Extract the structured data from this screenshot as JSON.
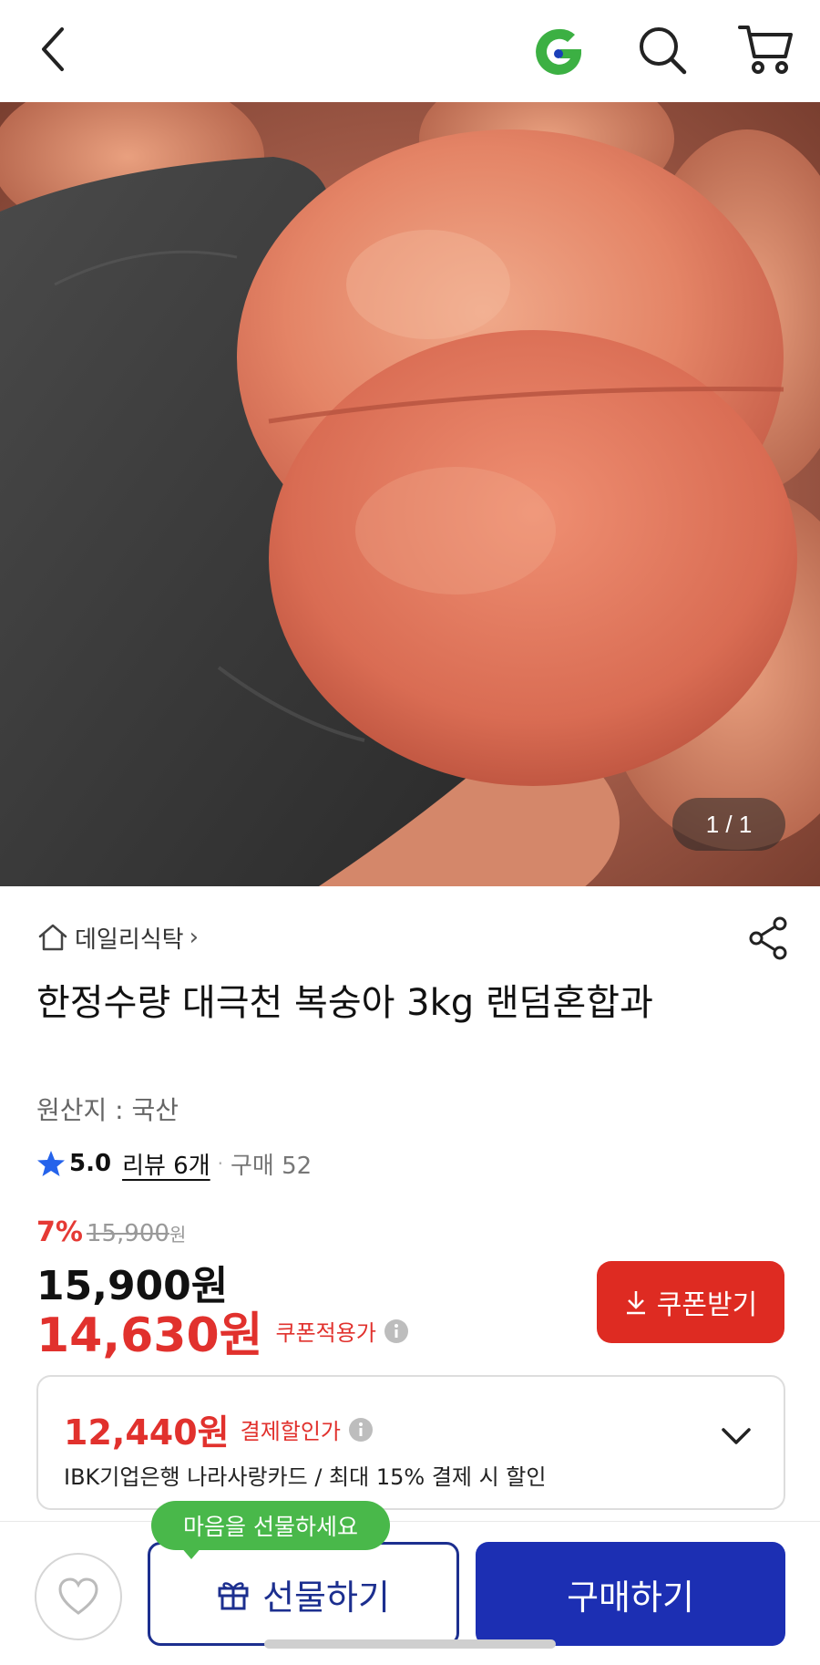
{
  "header": {
    "back_icon": "chevron-left-icon",
    "logo_icon": "gmarket-g-logo",
    "search_icon": "search-icon",
    "cart_icon": "cart-icon",
    "logo_color": "#3cb043"
  },
  "gallery": {
    "counter": "1 / 1"
  },
  "store": {
    "name": "데일리식탁",
    "chevron": "›"
  },
  "product": {
    "title": "한정수량 대극천 복숭아 3kg 랜덤혼합과",
    "origin": "원산지 : 국산",
    "rating": "5.0",
    "review_label": "리뷰 6개",
    "separator": "·",
    "purchase_label": "구매 52"
  },
  "pricing": {
    "discount_rate": "7%",
    "original_price": "15,900",
    "original_won": "원",
    "price": "15,900원",
    "coupon_price": "14,630원",
    "coupon_price_label": "쿠폰적용가",
    "coupon_button": "쿠폰받기",
    "accent_color": "#e1312d"
  },
  "card_discount": {
    "price": "12,440원",
    "label": "결제할인가",
    "description": "IBK기업은행 나라사랑카드 / 최대 15% 결제 시 할인"
  },
  "bottom_bar": {
    "tooltip": "마음을 선물하세요",
    "gift_button": "선물하기",
    "buy_button": "구매하기",
    "wish_icon": "heart-icon",
    "primary_color": "#1c2fb3"
  }
}
